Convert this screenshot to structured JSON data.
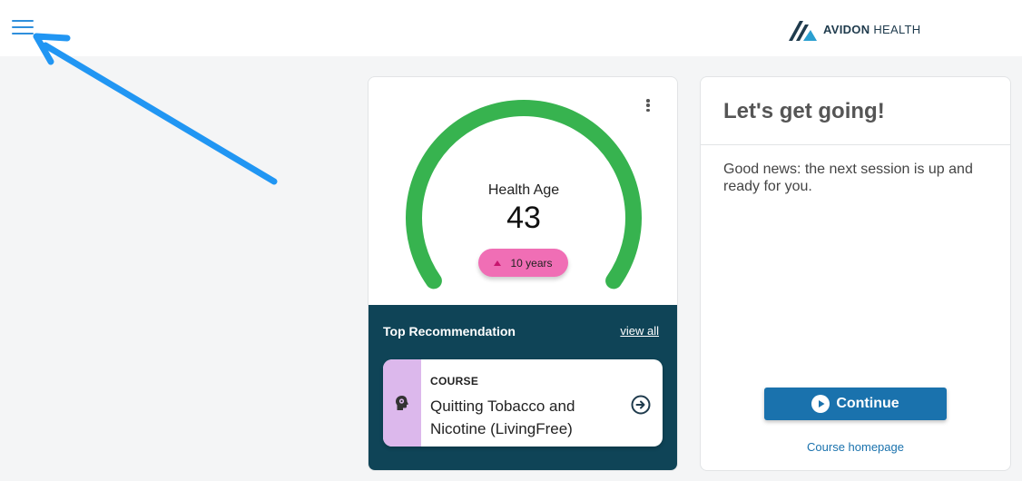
{
  "header": {
    "logo_bold": "AVIDON",
    "logo_light": "HEALTH"
  },
  "health_card": {
    "label": "Health Age",
    "value": "43",
    "badge": "10 years",
    "gauge_color": "#37b34f",
    "badge_color": "#f06eb5"
  },
  "recommendation": {
    "title": "Top Recommendation",
    "view_all": "view all",
    "course_type": "COURSE",
    "course_name": "Quitting Tobacco and Nicotine (LivingFree)",
    "background": "#0f4457"
  },
  "session_card": {
    "title": "Let's get going!",
    "message": "Good news: the next session is up and ready for you.",
    "continue_label": "Continue",
    "homepage_link": "Course homepage",
    "accent": "#1a72ad"
  },
  "icons": [
    "hamburger-menu-icon",
    "avidon-logo-icon",
    "more-vert-icon",
    "head-gear-icon",
    "arrow-circle-right-icon",
    "play-circle-icon",
    "annotation-arrow"
  ]
}
